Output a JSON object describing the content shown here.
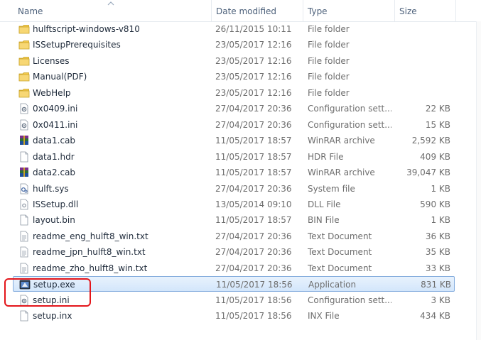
{
  "header": {
    "name": "Name",
    "date": "Date modified",
    "type": "Type",
    "size": "Size"
  },
  "colors": {
    "selection_border": "#84acdd",
    "selection_fill": "#d3e6fb",
    "highlight_box": "#e3151a",
    "folder": "#f2c94c"
  },
  "files": [
    {
      "name": "hulftscript-windows-v810",
      "date": "26/11/2015 10:11",
      "type": "File folder",
      "size": "",
      "icon": "folder-icon"
    },
    {
      "name": "ISSetupPrerequisites",
      "date": "23/05/2017 12:16",
      "type": "File folder",
      "size": "",
      "icon": "folder-icon"
    },
    {
      "name": "Licenses",
      "date": "23/05/2017 12:16",
      "type": "File folder",
      "size": "",
      "icon": "folder-icon"
    },
    {
      "name": "Manual(PDF)",
      "date": "23/05/2017 12:16",
      "type": "File folder",
      "size": "",
      "icon": "folder-icon"
    },
    {
      "name": "WebHelp",
      "date": "23/05/2017 12:16",
      "type": "File folder",
      "size": "",
      "icon": "folder-icon"
    },
    {
      "name": "0x0409.ini",
      "date": "27/04/2017 20:36",
      "type": "Configuration sett...",
      "size": "22 KB",
      "icon": "config-file-icon"
    },
    {
      "name": "0x0411.ini",
      "date": "27/04/2017 20:36",
      "type": "Configuration sett...",
      "size": "15 KB",
      "icon": "config-file-icon"
    },
    {
      "name": "data1.cab",
      "date": "11/05/2017 18:57",
      "type": "WinRAR archive",
      "size": "2,592 KB",
      "icon": "winrar-archive-icon"
    },
    {
      "name": "data1.hdr",
      "date": "11/05/2017 18:57",
      "type": "HDR File",
      "size": "409 KB",
      "icon": "blank-file-icon"
    },
    {
      "name": "data2.cab",
      "date": "11/05/2017 18:57",
      "type": "WinRAR archive",
      "size": "39,047 KB",
      "icon": "winrar-archive-icon"
    },
    {
      "name": "hulft.sys",
      "date": "27/04/2017 20:36",
      "type": "System file",
      "size": "1 KB",
      "icon": "system-file-icon"
    },
    {
      "name": "ISSetup.dll",
      "date": "13/05/2014 09:10",
      "type": "DLL File",
      "size": "590 KB",
      "icon": "dll-file-icon"
    },
    {
      "name": "layout.bin",
      "date": "11/05/2017 18:57",
      "type": "BIN File",
      "size": "1 KB",
      "icon": "blank-file-icon"
    },
    {
      "name": "readme_eng_hulft8_win.txt",
      "date": "27/04/2017 20:36",
      "type": "Text Document",
      "size": "36 KB",
      "icon": "text-file-icon"
    },
    {
      "name": "readme_jpn_hulft8_win.txt",
      "date": "27/04/2017 20:36",
      "type": "Text Document",
      "size": "35 KB",
      "icon": "text-file-icon"
    },
    {
      "name": "readme_zho_hulft8_win.txt",
      "date": "27/04/2017 20:36",
      "type": "Text Document",
      "size": "33 KB",
      "icon": "text-file-icon"
    },
    {
      "name": "setup.exe",
      "date": "11/05/2017 18:56",
      "type": "Application",
      "size": "831 KB",
      "icon": "application-icon",
      "selected": true
    },
    {
      "name": "setup.ini",
      "date": "11/05/2017 18:56",
      "type": "Configuration sett...",
      "size": "3 KB",
      "icon": "config-file-icon"
    },
    {
      "name": "setup.inx",
      "date": "11/05/2017 18:56",
      "type": "INX File",
      "size": "434 KB",
      "icon": "blank-file-icon"
    }
  ]
}
